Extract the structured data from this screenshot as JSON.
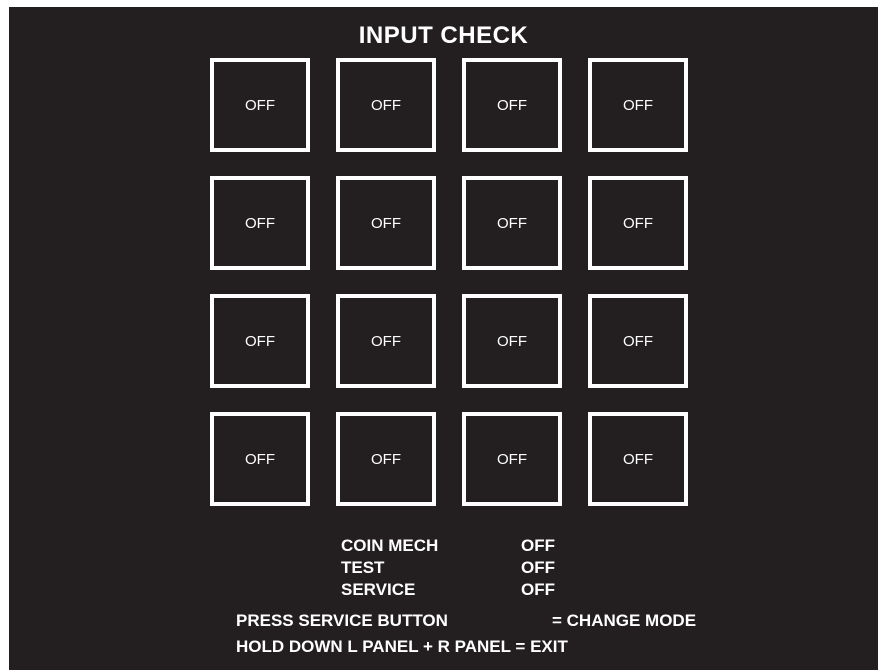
{
  "screen": {
    "title": "INPUT CHECK",
    "background_color": "#231f20",
    "text_color": "#ffffff"
  },
  "grid": {
    "cells": [
      "OFF",
      "OFF",
      "OFF",
      "OFF",
      "OFF",
      "OFF",
      "OFF",
      "OFF",
      "OFF",
      "OFF",
      "OFF",
      "OFF",
      "OFF",
      "OFF",
      "OFF",
      "OFF"
    ]
  },
  "status": [
    {
      "label": "COIN MECH",
      "value": "OFF"
    },
    {
      "label": "TEST",
      "value": "OFF"
    },
    {
      "label": "SERVICE",
      "value": "OFF"
    }
  ],
  "instructions": {
    "line1_key": "PRESS SERVICE BUTTON",
    "line1_action": "= CHANGE MODE",
    "line2": "HOLD DOWN L PANEL + R PANEL = EXIT"
  }
}
